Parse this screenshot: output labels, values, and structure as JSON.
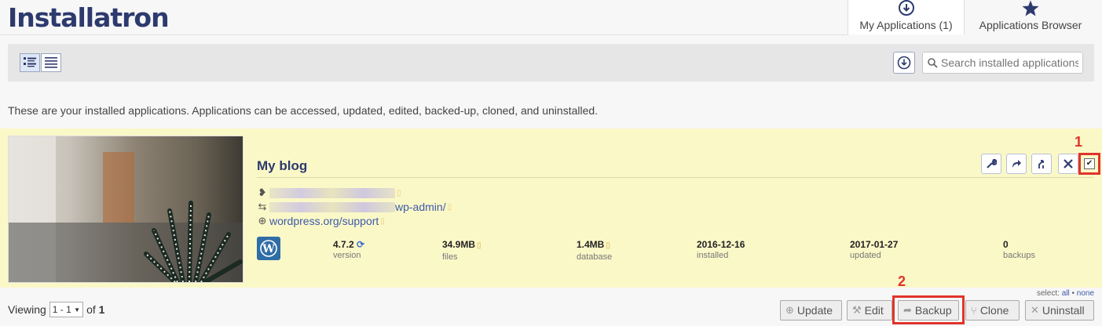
{
  "header": {
    "logo": "Installatron",
    "tabs": [
      {
        "label": "My Applications (1)",
        "icon": "download-circle-icon"
      },
      {
        "label": "Applications Browser",
        "icon": "star-icon"
      }
    ]
  },
  "toolbar": {
    "search_placeholder": "Search installed applications",
    "views": [
      "list-detail-icon",
      "list-compact-icon"
    ]
  },
  "intro": "These are your installed applications. Applications can be accessed, updated, edited, backed-up, cloned, and uninstalled.",
  "app": {
    "title": "My blog",
    "admin_link": "wp-admin/",
    "support_link": "wordpress.org/support",
    "stats": [
      {
        "value": "4.7.2",
        "label": "version"
      },
      {
        "value": "34.9MB",
        "label": "files"
      },
      {
        "value": "1.4MB",
        "label": "database"
      },
      {
        "value": "2016-12-16",
        "label": "installed"
      },
      {
        "value": "2017-01-27",
        "label": "updated"
      },
      {
        "value": "0",
        "label": "backups"
      }
    ],
    "checked": true
  },
  "annotations": {
    "one": "1",
    "two": "2"
  },
  "footer": {
    "viewing_label": "Viewing",
    "range": "1 - 1",
    "of_label": "of",
    "total": "1",
    "select_label": "select:",
    "select_all": "all",
    "select_sep": "•",
    "select_none": "none",
    "buttons": {
      "update": "Update",
      "edit": "Edit",
      "backup": "Backup",
      "clone": "Clone",
      "uninstall": "Uninstall"
    }
  },
  "colors": {
    "brand": "#2d3a6e",
    "row_bg": "#fbf8c8",
    "highlight": "#e0342a",
    "link": "#3c5aa8"
  }
}
